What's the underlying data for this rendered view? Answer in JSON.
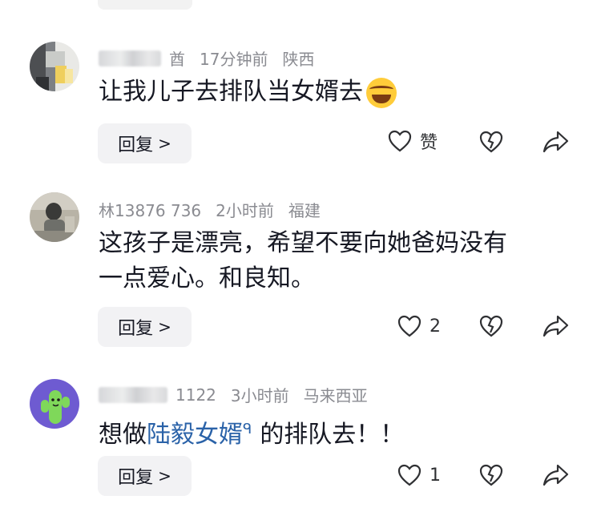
{
  "comments": [
    {
      "user_tail": "酋",
      "time": "17分钟前",
      "location": "陕西",
      "text_before": "让我儿子去排队当女婿去",
      "emoji": "laughing-crying-emoji",
      "reply_label": "回复",
      "like_label": "赞"
    },
    {
      "user_tail": "林13876   736",
      "time": "2小时前",
      "location": "福建",
      "text_line1": "这孩子是漂亮，希望不要向她爸妈没有",
      "text_line2": "一点爱心。和良知。",
      "reply_label": "回复",
      "like_count": "2"
    },
    {
      "user_tail": "1122",
      "time": "3小时前",
      "location": "马来西亚",
      "text_before": "想做",
      "text_link": "陆毅女婿",
      "text_after": "的排队去！！",
      "reply_label": "回复",
      "like_count": "1"
    }
  ],
  "icons": {
    "reply_chevron": ">",
    "search_glyph": "ᑫ"
  }
}
